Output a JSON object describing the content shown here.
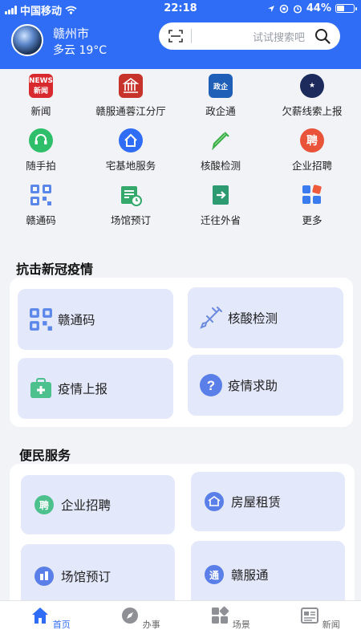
{
  "status_bar": {
    "carrier": "中国移动",
    "time": "22:18",
    "battery": "44%",
    "battery_level": 0.44
  },
  "header": {
    "city": "赣州市",
    "weather": "多云 19°C",
    "search_placeholder": "试试搜索吧",
    "brand_color": "#2f6df6"
  },
  "quick_grid": [
    {
      "label": "新闻",
      "icon": "news-icon"
    },
    {
      "label": "赣服通蓉江分厅",
      "icon": "building-icon"
    },
    {
      "label": "政企通",
      "icon": "zhengqitong-icon"
    },
    {
      "label": "欠薪线索上报",
      "icon": "police-badge-icon"
    },
    {
      "label": "随手拍",
      "icon": "headset-icon"
    },
    {
      "label": "宅基地服务",
      "icon": "home-icon"
    },
    {
      "label": "核酸检测",
      "icon": "pipette-icon"
    },
    {
      "label": "企业招聘",
      "icon": "recruit-icon"
    },
    {
      "label": "赣通码",
      "icon": "qr-code-icon"
    },
    {
      "label": "场馆预订",
      "icon": "calendar-icon"
    },
    {
      "label": "迁往外省",
      "icon": "exit-icon"
    },
    {
      "label": "更多",
      "icon": "more-icon"
    }
  ],
  "covid_section": {
    "title": "抗击新冠疫情",
    "cards": [
      {
        "label": "赣通码",
        "icon": "qr-code-icon"
      },
      {
        "label": "核酸检测",
        "icon": "syringe-icon"
      },
      {
        "label": "疫情上报",
        "icon": "medical-kit-icon"
      },
      {
        "label": "疫情求助",
        "icon": "help-icon"
      }
    ]
  },
  "service_section": {
    "title": "便民服务",
    "cards": [
      {
        "label": "企业招聘",
        "icon": "recruit-icon",
        "badge": "聘"
      },
      {
        "label": "房屋租赁",
        "icon": "house-rent-icon"
      },
      {
        "label": "场馆预订",
        "icon": "venue-icon"
      },
      {
        "label": "赣服通",
        "icon": "ganfutong-icon",
        "badge": "通"
      }
    ]
  },
  "tab_bar": [
    {
      "label": "首页",
      "icon": "home-tab-icon",
      "active": true
    },
    {
      "label": "办事",
      "icon": "compass-icon",
      "active": false
    },
    {
      "label": "场景",
      "icon": "scenes-icon",
      "active": false
    },
    {
      "label": "新闻",
      "icon": "newspaper-icon",
      "active": false
    }
  ]
}
